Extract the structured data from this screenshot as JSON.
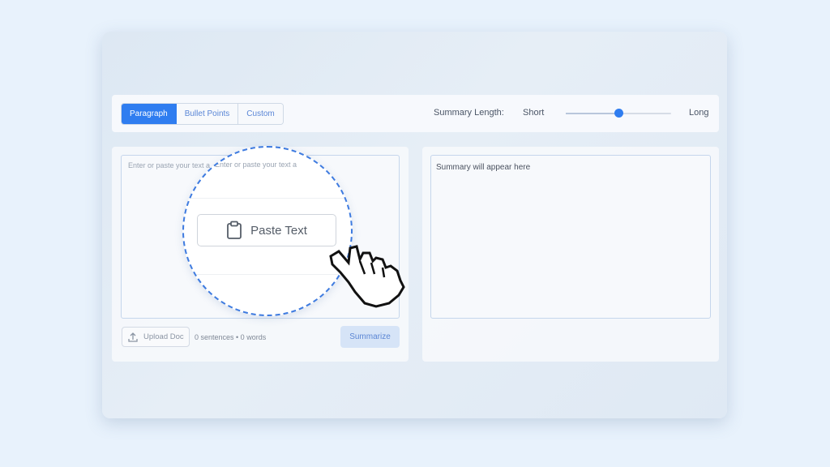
{
  "toolbar": {
    "modes": [
      {
        "label": "Paragraph",
        "active": true
      },
      {
        "label": "Bullet Points",
        "active": false
      },
      {
        "label": "Custom",
        "active": false
      }
    ],
    "summary_length_label": "Summary Length:",
    "short_label": "Short",
    "long_label": "Long",
    "slider_value_fraction": 0.5
  },
  "input_panel": {
    "placeholder": "Enter or paste your text a",
    "upload_label": "Upload Doc",
    "counts": "0 sentences • 0 words",
    "summarize_label": "Summarize"
  },
  "output_panel": {
    "placeholder": "Summary will appear here"
  },
  "magnifier": {
    "paste_label": "Paste Text"
  },
  "colors": {
    "accent": "#2f7df0",
    "background": "#e8f2fc",
    "magnifier_border": "#3e7be0"
  },
  "icons": [
    "upload-icon",
    "clipboard-icon",
    "hand-pointer-cursor-icon"
  ]
}
